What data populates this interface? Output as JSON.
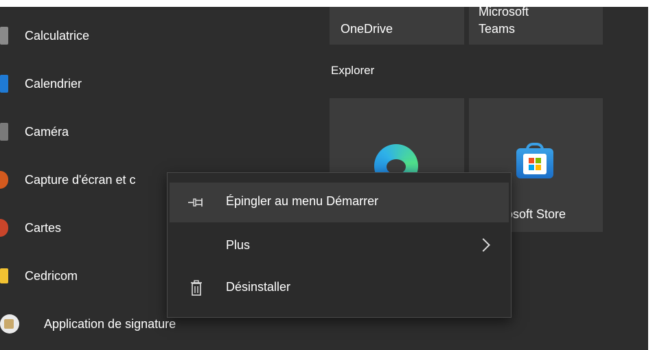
{
  "app_list": [
    {
      "label": "Calculatrice",
      "icon": "calculator-icon",
      "color": "#8a8a8a"
    },
    {
      "label": "Calendrier",
      "icon": "calendar-icon",
      "color": "#1f7ad4"
    },
    {
      "label": "Caméra",
      "icon": "camera-icon",
      "color": "#7a7a7a"
    },
    {
      "label": "Capture d'écran et c",
      "icon": "snip-icon",
      "color": "#d45a1e"
    },
    {
      "label": "Cartes",
      "icon": "maps-icon",
      "color": "#c9452a"
    },
    {
      "label": "Cedricom",
      "icon": "folder-icon",
      "color": "#f2c232"
    },
    {
      "label": "Application de signature",
      "icon": "signature-app-icon",
      "color": "#eaeaea"
    }
  ],
  "tiles": {
    "onedrive": {
      "label": "OneDrive"
    },
    "teams": {
      "label_line1": "Microsoft",
      "label_line2": "Teams"
    },
    "group_header": "Explorer",
    "edge": {
      "icon": "edge-icon"
    },
    "store": {
      "label": "osoft Store",
      "icon": "microsoft-store-icon"
    }
  },
  "context_menu": {
    "pin": {
      "label": "Épingler au menu Démarrer",
      "icon": "pin-icon"
    },
    "more": {
      "label": "Plus",
      "icon": "chevron-right-icon"
    },
    "uninstall": {
      "label": "Désinstaller",
      "icon": "trash-icon"
    }
  },
  "colors": {
    "background": "#2d2d2d",
    "tile": "#3c3c3c",
    "menu": "#2b2b2b",
    "menu_hover": "#3b3b3b"
  }
}
